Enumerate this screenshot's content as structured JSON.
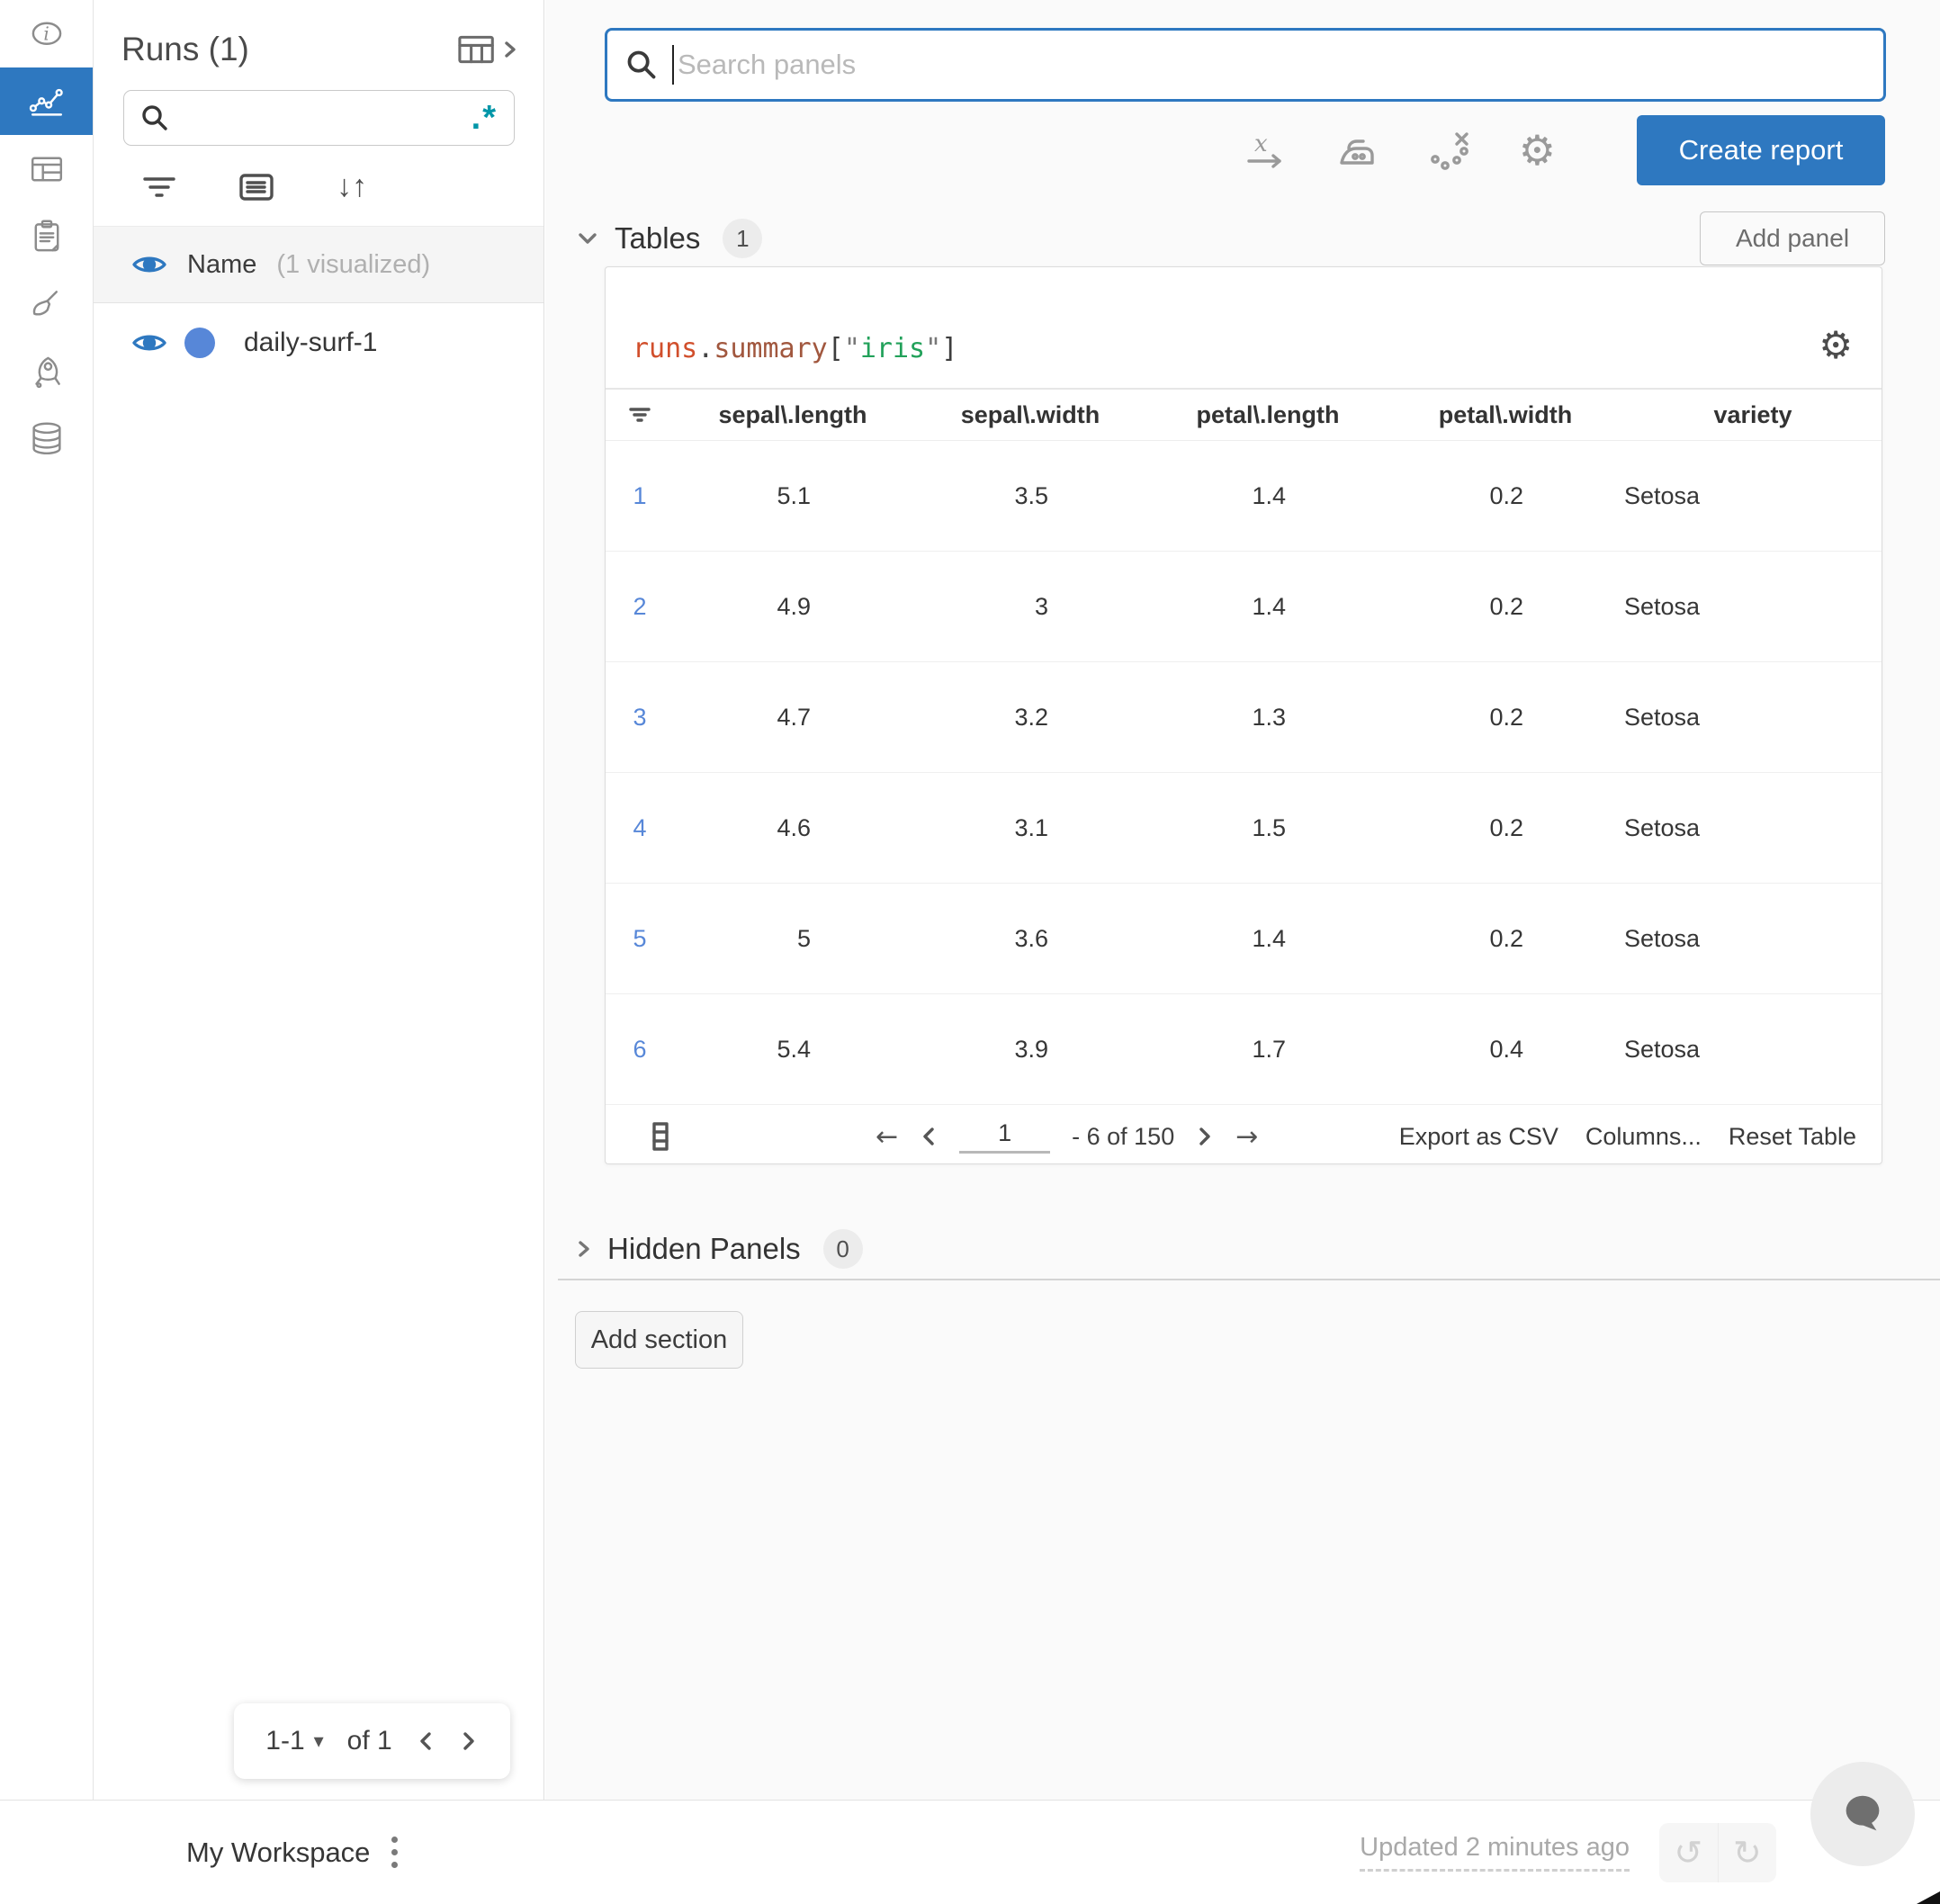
{
  "colors": {
    "accent": "#2e78c0",
    "run_dot": "#5787d8",
    "row_link": "#5787d8",
    "regex_teal": "#0096a8",
    "code_obj": "#d14f2c",
    "code_prop": "#a1573e",
    "code_string": "#22a15a",
    "main_bg": "#fafafa"
  },
  "icons": {
    "gear": "⚙",
    "undo": "↺",
    "redo": "↻",
    "dropdown": "▾",
    "arrow_left": "←",
    "arrow_right": "→",
    "sort": "↓↑"
  },
  "sidebar": {
    "title": "Runs (1)",
    "search": {
      "value": "",
      "regex": ".*"
    },
    "name_header": {
      "label": "Name",
      "annotation": "(1 visualized)"
    },
    "runs": [
      {
        "name": "daily-surf-1"
      }
    ],
    "pagination": {
      "range": "1-1",
      "of_label": "of 1"
    }
  },
  "topbar": {
    "search_placeholder": "Search panels",
    "create_report_label": "Create report"
  },
  "tables_section": {
    "title": "Tables",
    "count": "1",
    "add_panel_label": "Add panel"
  },
  "hidden_section": {
    "title": "Hidden Panels",
    "count": "0"
  },
  "add_section_label": "Add section",
  "panel": {
    "code": {
      "obj": "runs",
      "dot": ".",
      "prop": "summary",
      "bracket_open": "[",
      "quote_open": "\"",
      "key": "iris",
      "quote_close": "\"",
      "bracket_close": "]"
    },
    "table": {
      "columns": [
        "sepal\\.length",
        "sepal\\.width",
        "petal\\.length",
        "petal\\.width",
        "variety"
      ],
      "rows": [
        {
          "index": "1",
          "values": [
            "5.1",
            "3.5",
            "1.4",
            "0.2",
            "Setosa"
          ]
        },
        {
          "index": "2",
          "values": [
            "4.9",
            "3",
            "1.4",
            "0.2",
            "Setosa"
          ]
        },
        {
          "index": "3",
          "values": [
            "4.7",
            "3.2",
            "1.3",
            "0.2",
            "Setosa"
          ]
        },
        {
          "index": "4",
          "values": [
            "4.6",
            "3.1",
            "1.5",
            "0.2",
            "Setosa"
          ]
        },
        {
          "index": "5",
          "values": [
            "5",
            "3.6",
            "1.4",
            "0.2",
            "Setosa"
          ]
        },
        {
          "index": "6",
          "values": [
            "5.4",
            "3.9",
            "1.7",
            "0.4",
            "Setosa"
          ]
        }
      ]
    },
    "footer": {
      "page_value": "1",
      "range_label": "- 6 of 150",
      "export_label": "Export as CSV",
      "columns_label": "Columns...",
      "reset_label": "Reset Table"
    }
  },
  "bottombar": {
    "workspace": "My Workspace",
    "updated": "Updated 2 minutes ago"
  }
}
